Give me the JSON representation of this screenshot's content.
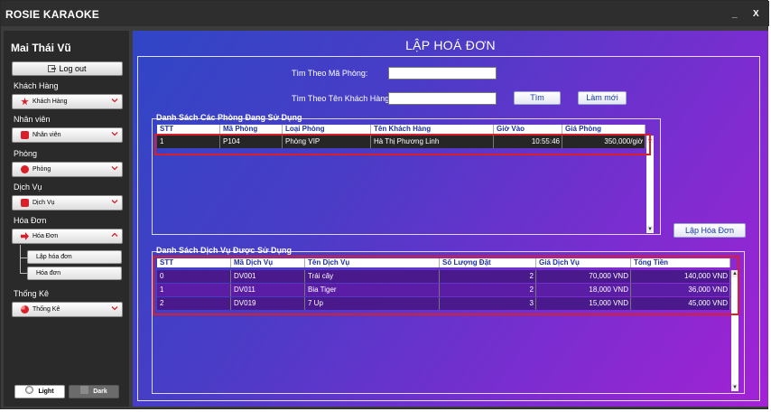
{
  "window": {
    "title": "ROSIE KARAOKE",
    "minimize": "_",
    "close": "X"
  },
  "sidebar": {
    "user_name": "Mai Thái Vũ",
    "logout_label": "Log out",
    "sections": [
      {
        "label": "Khách Hàng",
        "combo": "Khách Hàng",
        "icon": "customer-icon",
        "color": "#d9202a"
      },
      {
        "label": "Nhân viên",
        "combo": "Nhân viên",
        "icon": "employee-icon",
        "color": "#d9202a"
      },
      {
        "label": "Phòng",
        "combo": "Phòng",
        "icon": "room-icon",
        "color": "#d9202a"
      },
      {
        "label": "Dịch Vụ",
        "combo": "Dịch Vụ",
        "icon": "service-icon",
        "color": "#d9202a"
      },
      {
        "label": "Hóa Đơn",
        "combo": "Hóa Đơn",
        "icon": "invoice-icon",
        "color": "#d9202a"
      },
      {
        "label": "Thống Kê",
        "combo": "Thống Kê",
        "icon": "stats-icon",
        "color": "#d9202a"
      }
    ],
    "invoice_sub": [
      "Lập hóa đơn",
      "Hóa đơn"
    ],
    "theme": {
      "light": "Light",
      "dark": "Dark"
    }
  },
  "main": {
    "title": "LẬP HOÁ ĐƠN",
    "search_room_label": "Tìm Theo Mã Phòng:",
    "search_room_value": "",
    "search_customer_label": "Tìm Theo Tên Khách Hàng:",
    "search_customer_value": "",
    "search_button": "Tìm",
    "refresh_button": "Làm mới",
    "create_invoice_button": "Lập Hóa Đơn",
    "rooms_table": {
      "title": "Danh Sách Các Phòng Đang Sử Dụng",
      "headers": [
        "STT",
        "Mã Phòng",
        "Loại Phòng",
        "Tên Khách Hàng",
        "Giờ Vào",
        "Giá Phòng"
      ],
      "rows": [
        [
          "1",
          "P104",
          "Phòng VIP",
          "Hà Thị Phương Linh",
          "10:55:46",
          "350,000/giờ"
        ]
      ]
    },
    "services_table": {
      "title": "Danh Sách Dịch Vụ Được Sử Dụng",
      "headers": [
        "STT",
        "Mã Dịch Vụ",
        "Tên Dịch Vụ",
        "Số Lượng Đặt",
        "Giá Dịch Vụ",
        "Tổng Tiền"
      ],
      "rows": [
        [
          "0",
          "DV001",
          "Trái cây",
          "2",
          "70,000 VND",
          "140,000 VND"
        ],
        [
          "1",
          "DV011",
          "Bia Tiger",
          "2",
          "18,000 VND",
          "36,000 VND"
        ],
        [
          "2",
          "DV019",
          "7 Up",
          "3",
          "15,000 VND",
          "45,000 VND"
        ]
      ]
    }
  },
  "colors": {
    "accent_red": "#d9202a",
    "header_text": "#1a2ea8",
    "panel_bg_start": "#3046c6",
    "panel_bg_end": "#a322d4"
  }
}
